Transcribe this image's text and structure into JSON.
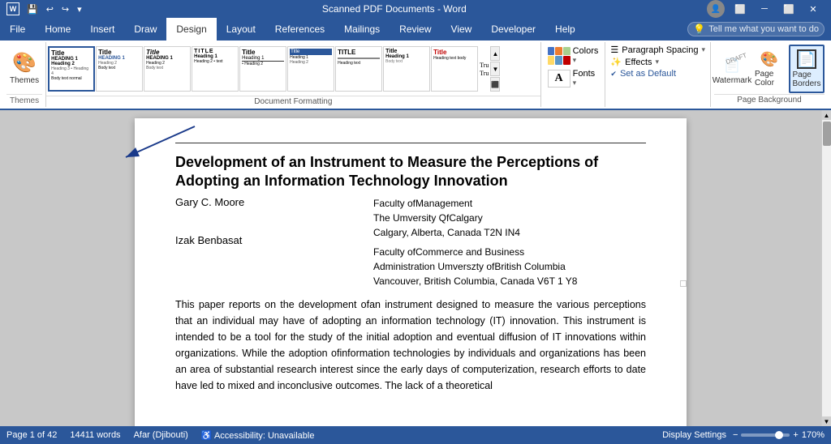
{
  "titlebar": {
    "title": "Scanned PDF Documents - Word",
    "app_name": "Word",
    "quick_access": [
      "undo",
      "redo",
      "save"
    ]
  },
  "ribbon": {
    "tabs": [
      {
        "id": "file",
        "label": "File"
      },
      {
        "id": "home",
        "label": "Home"
      },
      {
        "id": "insert",
        "label": "Insert"
      },
      {
        "id": "draw",
        "label": "Draw"
      },
      {
        "id": "design",
        "label": "Design",
        "active": true
      },
      {
        "id": "layout",
        "label": "Layout"
      },
      {
        "id": "references",
        "label": "References"
      },
      {
        "id": "mailings",
        "label": "Mailings"
      },
      {
        "id": "review",
        "label": "Review"
      },
      {
        "id": "view",
        "label": "View"
      },
      {
        "id": "developer",
        "label": "Developer"
      },
      {
        "id": "help",
        "label": "Help"
      }
    ],
    "groups": {
      "themes": {
        "label": "Themes",
        "button_label": "Themes"
      },
      "document_formatting": {
        "label": "Document Formatting",
        "styles": [
          {
            "label": "Title",
            "type": "title"
          },
          {
            "label": "Title",
            "type": "title2"
          },
          {
            "label": "Title",
            "type": "title3"
          },
          {
            "label": "Title",
            "type": "title4"
          },
          {
            "label": "Title",
            "type": "title5"
          },
          {
            "label": "Title",
            "type": "title6"
          },
          {
            "label": "TITLE",
            "type": "title-caps"
          },
          {
            "label": "Title",
            "type": "title7"
          }
        ]
      },
      "colors": {
        "label": "Colors",
        "button_label": "Colors"
      },
      "fonts": {
        "label": "Fonts",
        "button_label": "Fonts"
      },
      "paragraph_spacing": {
        "label": "Paragraph Spacing",
        "items": [
          {
            "label": "Paragraph Spacing"
          },
          {
            "label": "Effects"
          },
          {
            "label": "Set as Default"
          }
        ]
      },
      "page_background": {
        "label": "Page Background",
        "buttons": [
          {
            "label": "Watermark",
            "icon": "watermark"
          },
          {
            "label": "Page Color",
            "icon": "page-color"
          },
          {
            "label": "Page Borders",
            "icon": "page-borders",
            "active": true
          }
        ]
      }
    }
  },
  "tell_me": {
    "placeholder": "Tell me what you want to do",
    "icon": "lightbulb"
  },
  "document": {
    "title_line1": "Development of an Instrument to Measure the Perceptions of",
    "title_line2": "Adopting an Information Technology Innovation",
    "author1_name": "Gary C. Moore",
    "author1_affiliation_line1": "Faculty ofManagement",
    "author1_affiliation_line2": "The Umversity QfCalgary",
    "author1_affiliation_line3": "Calgary, Alberta, Canada T2N IN4",
    "author2_name": "Izak Benbasat",
    "author2_affiliation_line1": "Faculty     ofCommerce     and     Business",
    "author2_affiliation_line2": "Administration Umverszty ofBritish Columbia",
    "author2_affiliation_line3": "Vancouver, British Columbia, Canada V6T 1 Y8",
    "abstract": "This paper reports on the development ofan instrument designed to measure the various perceptions that an individual may have of adopting an information technology (IT) innovation. This instrument is intended to be a tool for the study of the initial adoption and eventual diffusion of IT innovations within organizations. While the adoption ofinformation technologies by individuals and organizations has been an area of substantial research interest since the early days of computerization, research efforts to date have led to mixed and inconclusive outcomes. The lack of a theoretical"
  },
  "status_bar": {
    "page_info": "Page 1 of 42",
    "word_count": "14411 words",
    "language": "Afar (Djibouti)",
    "accessibility": "Accessibility: Unavailable",
    "display_settings": "Display Settings",
    "zoom": "170%"
  },
  "colors": {
    "swatch1": "#4472c4",
    "swatch2": "#ed7d31",
    "swatch3": "#a9d18e",
    "swatch4": "#ffd966",
    "swatch5": "#5a96c8",
    "swatch6": "#c00000"
  }
}
